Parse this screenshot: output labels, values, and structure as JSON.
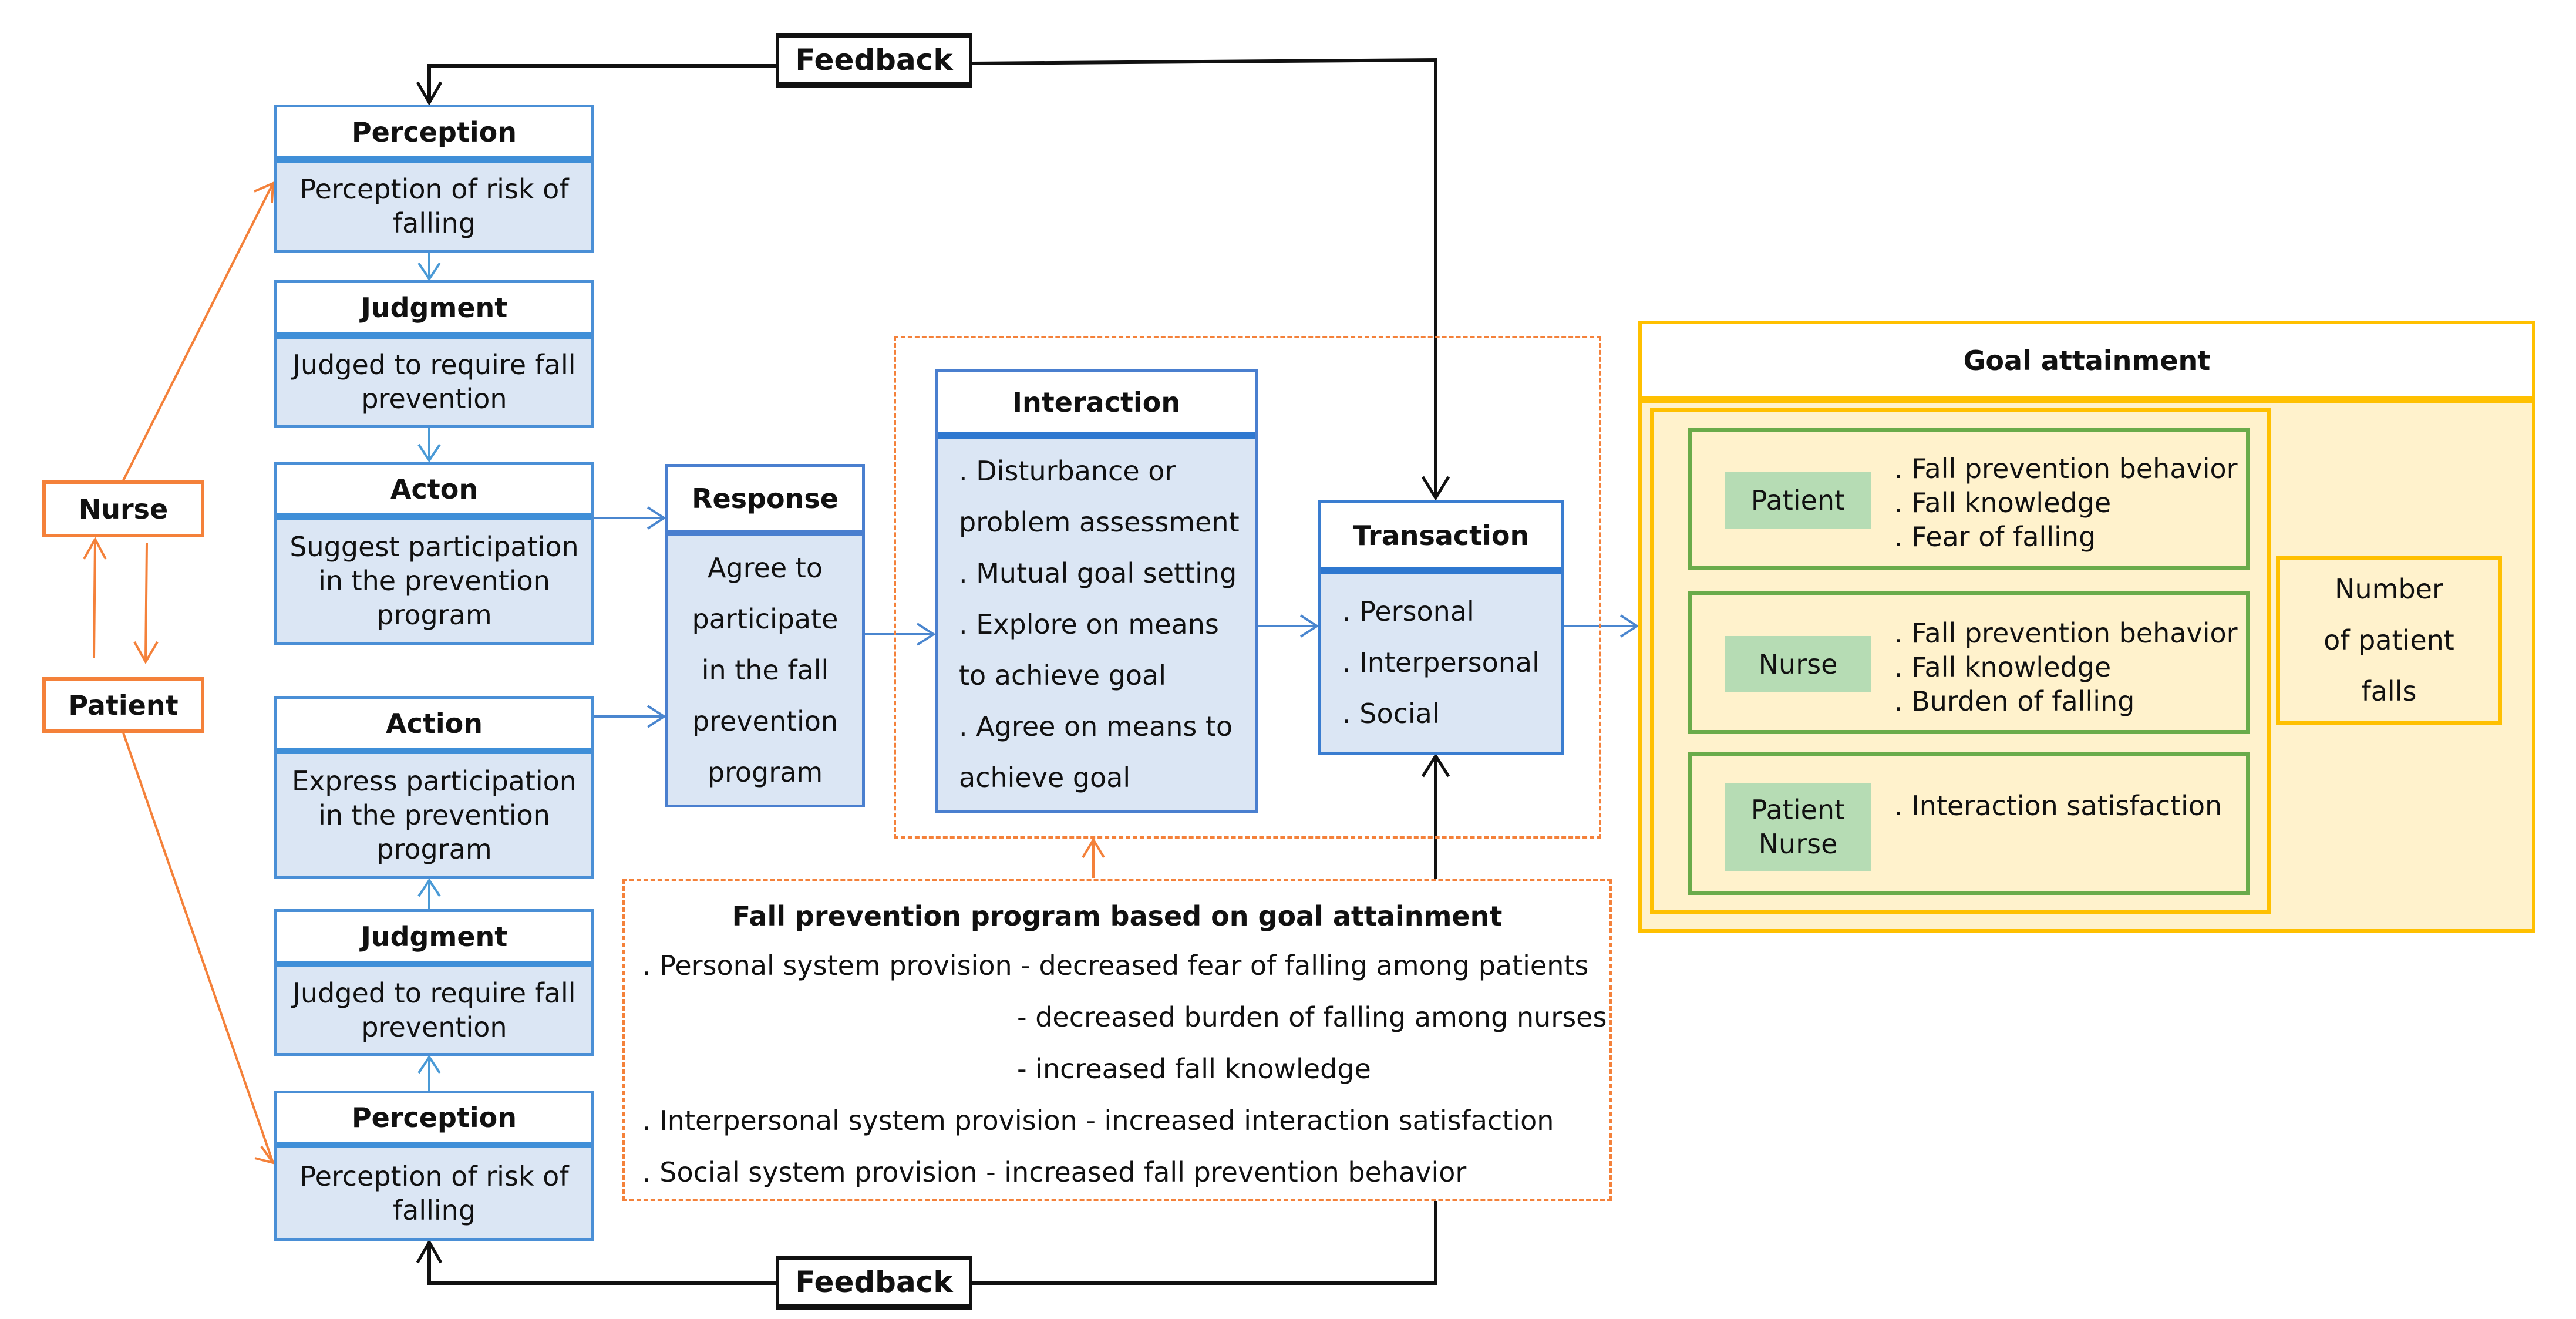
{
  "colors": {
    "blue_border": "#4a8fd6",
    "blue_fill": "#dbe6f4",
    "orange": "#f4813a",
    "gold": "#ffc000",
    "gold_fill": "#fff2cc",
    "green": "#6aab4a",
    "green_label": "#b6dcb4",
    "black": "#111111"
  },
  "feedback": {
    "top_label": "Feedback",
    "bottom_label": "Feedback"
  },
  "actors": {
    "nurse": "Nurse",
    "patient": "Patient"
  },
  "nurse_column": [
    {
      "title": "Perception",
      "body": "Perception of risk of falling"
    },
    {
      "title": "Judgment",
      "body": "Judged to require fall prevention"
    },
    {
      "title": "Acton",
      "body": "Suggest participation in the prevention program"
    }
  ],
  "patient_column": [
    {
      "title": "Action",
      "body": "Express participation in the prevention program"
    },
    {
      "title": "Judgment",
      "body": "Judged to require fall prevention"
    },
    {
      "title": "Perception",
      "body": "Perception of risk of falling"
    }
  ],
  "response": {
    "title": "Response",
    "body_lines": [
      "Agree to",
      "participate",
      "in the fall",
      "prevention",
      "program"
    ]
  },
  "interaction": {
    "title": "Interaction",
    "lines": [
      ". Disturbance or",
      "problem assessment",
      ". Mutual goal setting",
      ". Explore on means",
      "to achieve goal",
      ". Agree on means to",
      "achieve goal"
    ]
  },
  "transaction": {
    "title": "Transaction",
    "items": [
      ". Personal",
      ". Interpersonal",
      ". Social"
    ]
  },
  "program": {
    "title": "Fall prevention program based on goal attainment",
    "lines": [
      ". Personal system provision - decreased fear of falling among patients",
      "- decreased burden of falling among nurses",
      "- increased fall knowledge",
      ". Interpersonal system provision - increased interaction satisfaction",
      ". Social system provision - increased fall prevention behavior"
    ]
  },
  "goal_attainment": {
    "title": "Goal attainment",
    "groups": [
      {
        "label": "Patient",
        "items": [
          ". Fall prevention behavior",
          ". Fall knowledge",
          ". Fear of falling"
        ]
      },
      {
        "label": "Nurse",
        "items": [
          ". Fall prevention behavior",
          ". Fall knowledge",
          ". Burden of falling"
        ]
      },
      {
        "label_lines": [
          "Patient",
          "Nurse"
        ],
        "items": [
          ". Interaction satisfaction"
        ]
      }
    ],
    "outcome_lines": [
      "Number",
      "of patient",
      "falls"
    ]
  }
}
